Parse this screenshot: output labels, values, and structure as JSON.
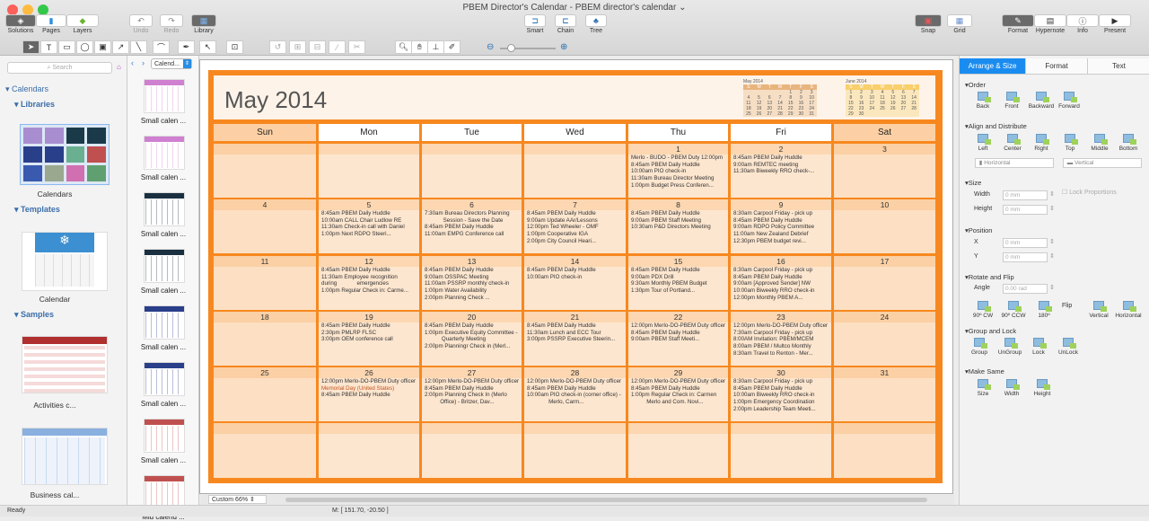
{
  "window": {
    "title": "PBEM Director's Calendar - PBEM director's calendar ⌄"
  },
  "toolbar": {
    "solutions": "Solutions",
    "pages": "Pages",
    "layers": "Layers",
    "undo": "Undo",
    "redo": "Redo",
    "library": "Library",
    "smart": "Smart",
    "chain": "Chain",
    "tree": "Tree",
    "snap": "Snap",
    "grid": "Grid",
    "format": "Format",
    "hypernote": "Hypernote",
    "info": "Info",
    "present": "Present"
  },
  "library": {
    "search_placeholder": "Search",
    "calendars": "Calendars",
    "libraries": "Libraries",
    "calendars_item": "Calendars",
    "templates": "Templates",
    "calendar_item": "Calendar",
    "samples": "Samples",
    "sample1": "Activities c...",
    "sample2": "Business cal..."
  },
  "thumbs": {
    "dropdown": "Calend...",
    "items": [
      "Small calen ...",
      "Small calen ...",
      "Small calen ...",
      "Small calen ...",
      "Small calen ...",
      "Small calen ...",
      "Small calen ...",
      "Mid calend ..."
    ]
  },
  "calendar": {
    "title": "May 2014",
    "accent": "#f7881f",
    "weekdays": [
      "Sun",
      "Mon",
      "Tue",
      "Wed",
      "Thu",
      "Fri",
      "Sat"
    ],
    "weeks": [
      [
        {
          "d": "",
          "e": []
        },
        {
          "d": "",
          "e": []
        },
        {
          "d": "",
          "e": []
        },
        {
          "d": "",
          "e": []
        },
        {
          "d": "1",
          "e": [
            "Merlo - BUDO - PBEM Duty 12:00pm",
            "8:45am PBEM Daily Huddle",
            "10:00am PIO check-in",
            "11:30am Bureau Director Meeting",
            "1:00pm Budget Press Conferen..."
          ]
        },
        {
          "d": "2",
          "e": [
            "8:45am PBEM Daily Huddle",
            "",
            "9:00am REMTEC meeting",
            "",
            "11:30am Biweekly RRO check-..."
          ]
        },
        {
          "d": "3",
          "e": []
        }
      ],
      [
        {
          "d": "4",
          "e": []
        },
        {
          "d": "5",
          "e": [
            "8:45am PBEM Daily Huddle",
            "",
            "10:00am CALL Chair Ludlow RE",
            "11:30am Check-in call with Daniel",
            "1:00pm Next RDPO Steeri..."
          ]
        },
        {
          "d": "6",
          "e": [
            "7:30am Bureau Directors Planning",
            "            Session - Save the Date",
            "8:45am PBEM Daily Huddle",
            "",
            "11:00am EMPG Conference call"
          ]
        },
        {
          "d": "7",
          "e": [
            "8:45am PBEM Daily Huddle",
            "9:00am Update AAr/Lessons",
            "12:00pm Ted Wheeler - OMF",
            "1:00pm Cooperative IGA",
            "2:00pm City Council Heari..."
          ]
        },
        {
          "d": "8",
          "e": [
            "8:45am PBEM Daily Huddle",
            "",
            "9:00am PBEM Staff Meeting",
            "",
            "10:30am P&D Directors Meeting"
          ]
        },
        {
          "d": "9",
          "e": [
            "8:30am Carpool Friday - pick up",
            "8:45am PBEM Daily Huddle",
            "9:00am RDPO Policy Committee",
            "11:00am New Zealand Debrief",
            "12:30pm PBEM budget revi..."
          ]
        },
        {
          "d": "10",
          "e": []
        }
      ],
      [
        {
          "d": "11",
          "e": []
        },
        {
          "d": "12",
          "e": [
            "8:45am PBEM Daily Huddle",
            "",
            "11:30am Employee recognition",
            "during             emergencies",
            "1:00pm Regular Check in: Carme..."
          ]
        },
        {
          "d": "13",
          "e": [
            "8:45am PBEM Daily Huddle",
            "9:00am OSSPAC Meeting",
            "11:00am PSSRP monthly check-in",
            "1:00pm Water Availability",
            "2:00pm Planning Check ..."
          ]
        },
        {
          "d": "14",
          "e": [
            "8:45am PBEM Daily Huddle",
            "",
            "10:00am PIO check-in"
          ]
        },
        {
          "d": "15",
          "e": [
            "8:45am PBEM Daily Huddle",
            "",
            "9:00am PDX Drill",
            "9:30am Monthly PBEM Budget",
            "1:30pm Tour of Portland..."
          ]
        },
        {
          "d": "16",
          "e": [
            "8:30am Carpool Friday - pick up",
            "8:45am PBEM Daily Huddle",
            "9:00am [Approved Sender] NW",
            "10:00am Biweekly RRO check-in",
            "12:00pm Monthly PBEM A..."
          ]
        },
        {
          "d": "17",
          "e": []
        }
      ],
      [
        {
          "d": "18",
          "e": []
        },
        {
          "d": "19",
          "e": [
            "8:45am PBEM Daily Huddle",
            "",
            "2:30pm PMLRP FLSC",
            "",
            "3:00pm OEM conference call"
          ]
        },
        {
          "d": "20",
          "e": [
            "8:45am PBEM Daily Huddle",
            "",
            "1:00pm Executive Equity Committee -",
            "           Quarterly Meeting",
            "2:00pm Planningr Check in (Merl..."
          ]
        },
        {
          "d": "21",
          "e": [
            "8:45am PBEM Daily Huddle",
            "",
            "11:30am Lunch and ECC Tour",
            "",
            "3:00pm PSSRP Executive Steerin..."
          ]
        },
        {
          "d": "22",
          "e": [
            "12:00pm Merlo-DO-PBEM Duty officer",
            "8:45am PBEM Daily Huddle",
            "",
            "9:00am PBEM Staff Meeti..."
          ]
        },
        {
          "d": "23",
          "e": [
            "12:00pm Merlo-DO-PBEM Duty officer",
            "7:30am Carpool Friday - pick up",
            "8:00AM Invitation: PBEM/MCEM",
            "8:00am PBEM / Multco Monthly",
            "8:30am Travel to Renton - Mer..."
          ]
        },
        {
          "d": "24",
          "e": []
        }
      ],
      [
        {
          "d": "25",
          "e": []
        },
        {
          "d": "26",
          "e": [
            "12:00pm Merlo-DO-PBEM Duty officer",
            "",
            "Memorial Day (United States)",
            "",
            "8:45am PBEM Daily Huddle"
          ],
          "holiday": 2
        },
        {
          "d": "27",
          "e": [
            "12:00pm Merlo-DO-PBEM Duty officer",
            "8:45am PBEM Daily Huddle",
            "",
            "2:00pm Planning Check In (Merlo",
            "          Office) - Britzer, Dav..."
          ]
        },
        {
          "d": "28",
          "e": [
            "12:00pm Merlo-DO-PBEM Duty officer",
            "8:45am PBEM Daily Huddle",
            "",
            "10:00am PIO check-in (corner office) -",
            "              Merlo, Carm..."
          ]
        },
        {
          "d": "29",
          "e": [
            "12:00pm Merlo-DO-PBEM Duty officer",
            "8:45am PBEM Daily Huddle",
            "",
            "1:00pm Regular Check in: Carmen",
            "          Merlo and Com. Novi..."
          ]
        },
        {
          "d": "30",
          "e": [
            "8:30am Carpool Friday - pick up",
            "8:45am PBEM Daily Huddle",
            "10:00am Biweekly RRO check-in",
            "1:00pm Emergency Coordination",
            "2:00pm Leadership Team Meeti..."
          ]
        },
        {
          "d": "31",
          "e": []
        }
      ],
      [
        {
          "d": "",
          "e": []
        },
        {
          "d": "",
          "e": []
        },
        {
          "d": "",
          "e": []
        },
        {
          "d": "",
          "e": []
        },
        {
          "d": "",
          "e": []
        },
        {
          "d": "",
          "e": []
        },
        {
          "d": "",
          "e": []
        }
      ]
    ],
    "mini": [
      {
        "title": "May 2014",
        "head": [
          "S",
          "M",
          "T",
          "W",
          "T",
          "F",
          "S"
        ],
        "days": [
          "",
          "",
          "",
          "",
          "1",
          "2",
          "3",
          "4",
          "5",
          "6",
          "7",
          "8",
          "9",
          "10",
          "11",
          "12",
          "13",
          "14",
          "15",
          "16",
          "17",
          "18",
          "19",
          "20",
          "21",
          "22",
          "23",
          "24",
          "25",
          "26",
          "27",
          "28",
          "29",
          "30",
          "31"
        ],
        "color": "#e8b47e"
      },
      {
        "title": "June 2014",
        "head": [
          "S",
          "M",
          "T",
          "W",
          "T",
          "F",
          "S"
        ],
        "days": [
          "1",
          "2",
          "3",
          "4",
          "5",
          "6",
          "7",
          "8",
          "9",
          "10",
          "11",
          "12",
          "13",
          "14",
          "15",
          "16",
          "17",
          "18",
          "19",
          "20",
          "21",
          "22",
          "23",
          "24",
          "25",
          "26",
          "27",
          "28",
          "29",
          "30"
        ],
        "color": "#f8cf6a"
      }
    ]
  },
  "canvas": {
    "zoom": "Custom 66%"
  },
  "panel": {
    "tabs": [
      "Arrange & Size",
      "Format",
      "Text"
    ],
    "active_color": "#1a8cf0",
    "order": "Order",
    "order_btns": [
      "Back",
      "Front",
      "Backward",
      "Forward"
    ],
    "align": "Align and Distribute",
    "align_btns": [
      "Left",
      "Center",
      "Right",
      "Top",
      "Middle",
      "Bottom"
    ],
    "horizontal": "Horizontal",
    "vertical": "Vertical",
    "size": "Size",
    "width": "Width",
    "height": "Height",
    "width_val": "0 mm",
    "height_val": "0 mm",
    "lock": "Lock Proportions",
    "position": "Position",
    "x": "X",
    "y": "Y",
    "x_val": "0 mm",
    "y_val": "0 mm",
    "rotate": "Rotate and Flip",
    "angle": "Angle",
    "angle_val": "0.00 rad",
    "rot_btns": [
      "90º CW",
      "90º CCW",
      "180º"
    ],
    "flip": "Flip",
    "flip_btns": [
      "Vertical",
      "Horizontal"
    ],
    "group": "Group and Lock",
    "group_btns": [
      "Group",
      "UnGroup",
      "Lock",
      "UnLock"
    ],
    "same": "Make Same",
    "same_btns": [
      "Size",
      "Width",
      "Height"
    ]
  },
  "status": {
    "left": "Ready",
    "coords": "M: [ 151.70, -20.50 ]"
  }
}
